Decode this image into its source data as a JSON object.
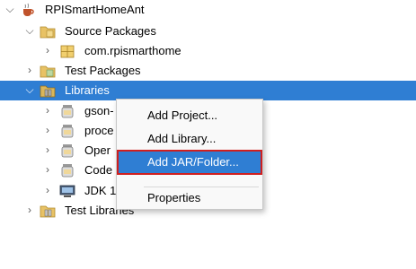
{
  "tree": {
    "project": {
      "label": "RPISmartHomeAnt",
      "icon": "project-coffee-cup-icon"
    },
    "source_packages": {
      "label": "Source Packages",
      "icon": "source-folder-icon"
    },
    "package": {
      "label": "com.rpismarthome",
      "icon": "package-icon"
    },
    "test_packages": {
      "label": "Test Packages",
      "icon": "test-folder-icon"
    },
    "libraries": {
      "label": "Libraries",
      "icon": "libraries-folder-icon"
    },
    "lib_items": [
      {
        "label": "gson-",
        "icon": "jar-icon"
      },
      {
        "label": "proce",
        "icon": "jar-icon"
      },
      {
        "label": "Oper",
        "icon": "jar-icon"
      },
      {
        "label": "Code",
        "icon": "jar-icon"
      },
      {
        "label": "JDK 1",
        "icon": "jdk-icon"
      }
    ],
    "test_libraries": {
      "label": "Test Libraries",
      "icon": "test-libraries-folder-icon"
    }
  },
  "context_menu": {
    "items": [
      "Add Project...",
      "Add Library...",
      "Add JAR/Folder...",
      "Properties"
    ],
    "highlighted": "Add JAR/Folder..."
  },
  "colors": {
    "selection": "#2f7ed3",
    "highlight_border": "#cf1f1f"
  }
}
